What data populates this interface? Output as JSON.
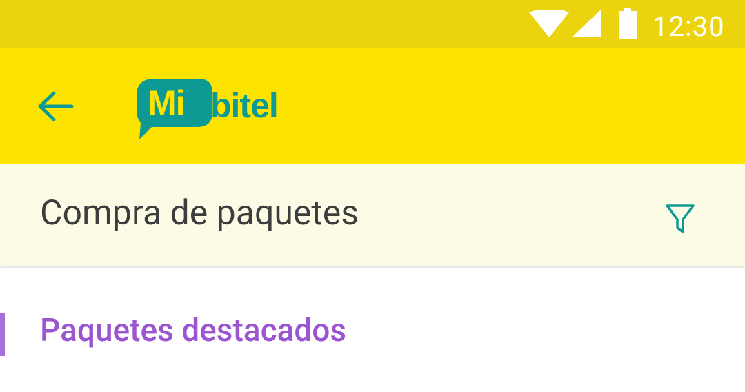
{
  "status_bar": {
    "time": "12:30",
    "icons": [
      "wifi-icon",
      "signal-icon",
      "battery-icon"
    ],
    "background": "#EBD40E"
  },
  "app_bar": {
    "back_icon": "arrow-left-icon",
    "logo": {
      "prefix": "Mi",
      "suffix": "bitel"
    },
    "background": "#FDE400",
    "accent": "#0E9A94"
  },
  "section_header": {
    "title": "Compra de paquetes",
    "filter_icon": "filter-icon",
    "background": "#FCFCE6"
  },
  "featured": {
    "title": "Paquetes destacados",
    "color": "#9B55D0"
  }
}
